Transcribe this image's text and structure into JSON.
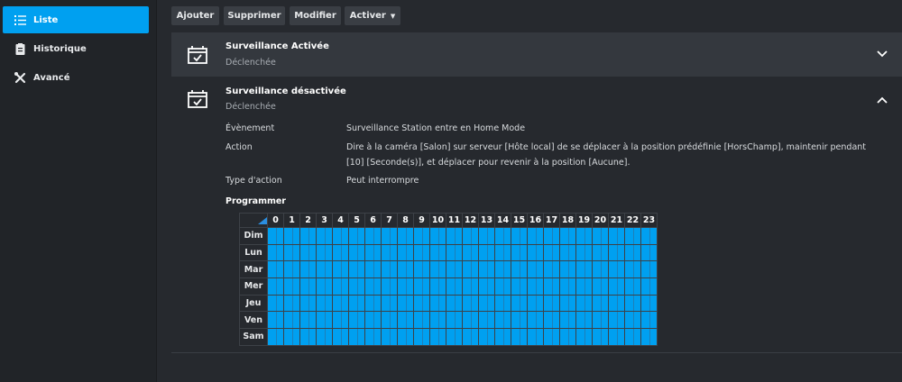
{
  "sidebar": {
    "items": [
      {
        "label": "Liste",
        "icon": "list-icon",
        "active": true
      },
      {
        "label": "Historique",
        "icon": "clipboard-icon"
      },
      {
        "label": "Avancé",
        "icon": "tools-icon"
      }
    ]
  },
  "toolbar": {
    "add": "Ajouter",
    "delete": "Supprimer",
    "edit": "Modifier",
    "activate": "Activer"
  },
  "rules": [
    {
      "title": "Surveillance Activée",
      "status": "Déclenchée",
      "expanded": false
    },
    {
      "title": "Surveillance désactivée",
      "status": "Déclenchée",
      "expanded": true,
      "details": {
        "event_label": "Évènement",
        "event": "Surveillance Station entre en Home Mode",
        "action_label": "Action",
        "action": "Dire à la caméra [Salon] sur serveur [Hôte local] de se déplacer à la position prédéfinie [HorsChamp], maintenir pendant [10] [Seconde(s)], et déplacer pour revenir à la position [Aucune].",
        "type_label": "Type d'action",
        "type": "Peut interrompre",
        "schedule_label": "Programmer"
      }
    }
  ],
  "schedule": {
    "hours": [
      "0",
      "1",
      "2",
      "3",
      "4",
      "5",
      "6",
      "7",
      "8",
      "9",
      "10",
      "11",
      "12",
      "13",
      "14",
      "15",
      "16",
      "17",
      "18",
      "19",
      "20",
      "21",
      "22",
      "23"
    ],
    "days": [
      "Dim",
      "Lun",
      "Mar",
      "Mer",
      "Jeu",
      "Ven",
      "Sam"
    ],
    "all_active": true,
    "active_color": "#00a0f0"
  }
}
